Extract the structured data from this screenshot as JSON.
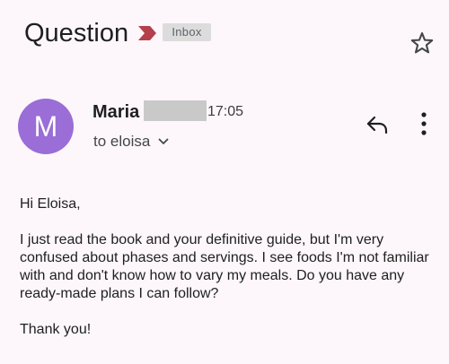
{
  "header": {
    "subject": "Question",
    "label": "Inbox",
    "importance_icon": "importance-marker-icon",
    "star_icon": "star-outline-icon",
    "importance_color": "#b3404a"
  },
  "message": {
    "sender_name": "Maria",
    "sender_initial": "M",
    "time": "17:05",
    "recipient": "to eloisa",
    "avatar_color": "#9b6dd7",
    "reply_icon": "reply-icon",
    "more_icon": "more-vertical-icon"
  },
  "body": {
    "greeting": "Hi Eloisa,",
    "paragraph": "I just read the book and your definitive guide, but I'm very confused about phases and servings. I see foods I'm not familiar with and don't know how to vary my meals. Do you have any ready-made plans I can follow?",
    "closing": "Thank you!"
  }
}
